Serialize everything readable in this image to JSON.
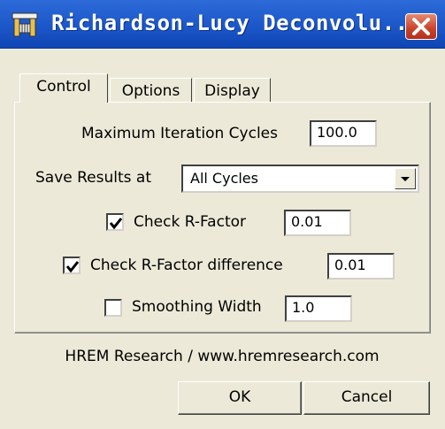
{
  "window": {
    "title": "Richardson-Lucy Deconvolu...",
    "app_icon": "deconvolution-app-icon",
    "close_icon": "close-icon"
  },
  "tabs": [
    {
      "label": "Control",
      "active": true
    },
    {
      "label": "Options",
      "active": false
    },
    {
      "label": "Display",
      "active": false
    }
  ],
  "control": {
    "max_iterations_label": "Maximum Iteration Cycles",
    "max_iterations_value": "100.0",
    "save_results_label": "Save Results at",
    "save_results_value": "All Cycles",
    "check_rfactor_label": "Check R-Factor",
    "check_rfactor_checked": true,
    "check_rfactor_value": "0.01",
    "check_rfactor_diff_label": "Check R-Factor difference",
    "check_rfactor_diff_checked": true,
    "check_rfactor_diff_value": "0.01",
    "smoothing_label": "Smoothing Width",
    "smoothing_checked": false,
    "smoothing_value": "1.0"
  },
  "footer": {
    "credit": "HREM Research / www.hremresearch.com",
    "ok_label": "OK",
    "cancel_label": "Cancel"
  },
  "colors": {
    "titlebar": "#1c57c9",
    "close_button": "#c9432a",
    "dialog_background": "#ece9d8"
  }
}
